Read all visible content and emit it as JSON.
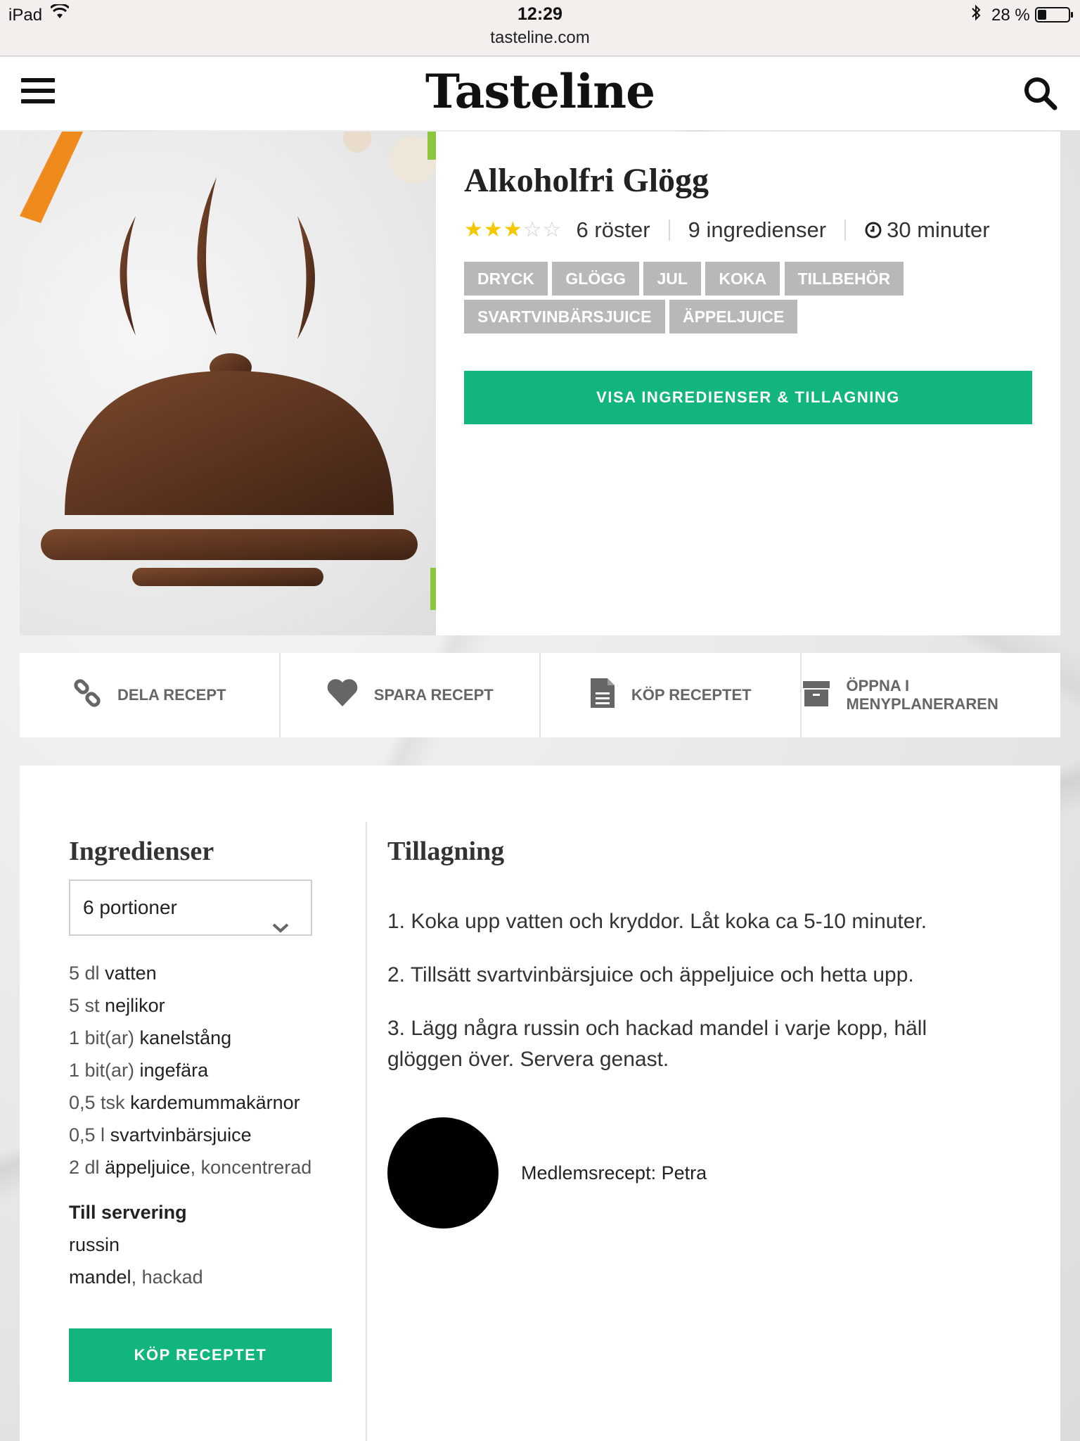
{
  "status_bar": {
    "device": "iPad",
    "time": "12:29",
    "url": "tasteline.com",
    "battery": "28 %"
  },
  "header": {
    "logo": "Tasteline"
  },
  "recipe": {
    "title": "Alkoholfri Glögg",
    "rating": 3,
    "rating_max": 5,
    "votes": "6 röster",
    "ingredient_count": "9 ingredienser",
    "time": "30 minuter",
    "tags": [
      "DRYCK",
      "GLÖGG",
      "JUL",
      "KOKA",
      "TILLBEHÖR",
      "SVARTVINBÄRSJUICE",
      "ÄPPELJUICE"
    ],
    "show_button": "VISA INGREDIENSER & TILLAGNING"
  },
  "actions": [
    {
      "label": "DELA RECEPT",
      "icon": "link-icon"
    },
    {
      "label": "SPARA RECEPT",
      "icon": "heart-icon"
    },
    {
      "label": "KÖP RECEPTET",
      "icon": "document-icon"
    },
    {
      "label": "ÖPPNA I MENYPLANERAREN",
      "icon": "archive-icon"
    }
  ],
  "ingredients_section": {
    "heading": "Ingredienser",
    "portions": "6 portioner",
    "items": [
      {
        "amount": "5 dl",
        "name": "vatten",
        "note": ""
      },
      {
        "amount": "5 st",
        "name": "nejlikor",
        "note": ""
      },
      {
        "amount": "1 bit(ar)",
        "name": "kanelstång",
        "note": ""
      },
      {
        "amount": "1 bit(ar)",
        "name": "ingefära",
        "note": ""
      },
      {
        "amount": "0,5 tsk",
        "name": "kardemummakärnor",
        "note": ""
      },
      {
        "amount": "0,5 l",
        "name": "svartvinbärsjuice",
        "note": ""
      },
      {
        "amount": "2 dl",
        "name": "äppeljuice",
        "note": ", koncentrerad"
      }
    ],
    "serving_heading": "Till servering",
    "serving_items": [
      {
        "amount": "",
        "name": "russin",
        "note": ""
      },
      {
        "amount": "",
        "name": "mandel",
        "note": ", hackad"
      }
    ],
    "buy_button": "KÖP RECEPTET"
  },
  "preparation": {
    "heading": "Tillagning",
    "steps": [
      "1. Koka upp vatten och kryddor. Låt koka ca 5-10 minuter.",
      "2. Tillsätt svartvinbärsjuice och äppeljuice och hetta upp.",
      "3. Lägg några russin och hackad mandel i varje kopp, häll glöggen över. Servera genast."
    ],
    "author": "Medlemsrecept: Petra"
  },
  "colors": {
    "accent": "#12b67d",
    "tag_bg": "#b8b8b8",
    "star": "#f3c800"
  }
}
